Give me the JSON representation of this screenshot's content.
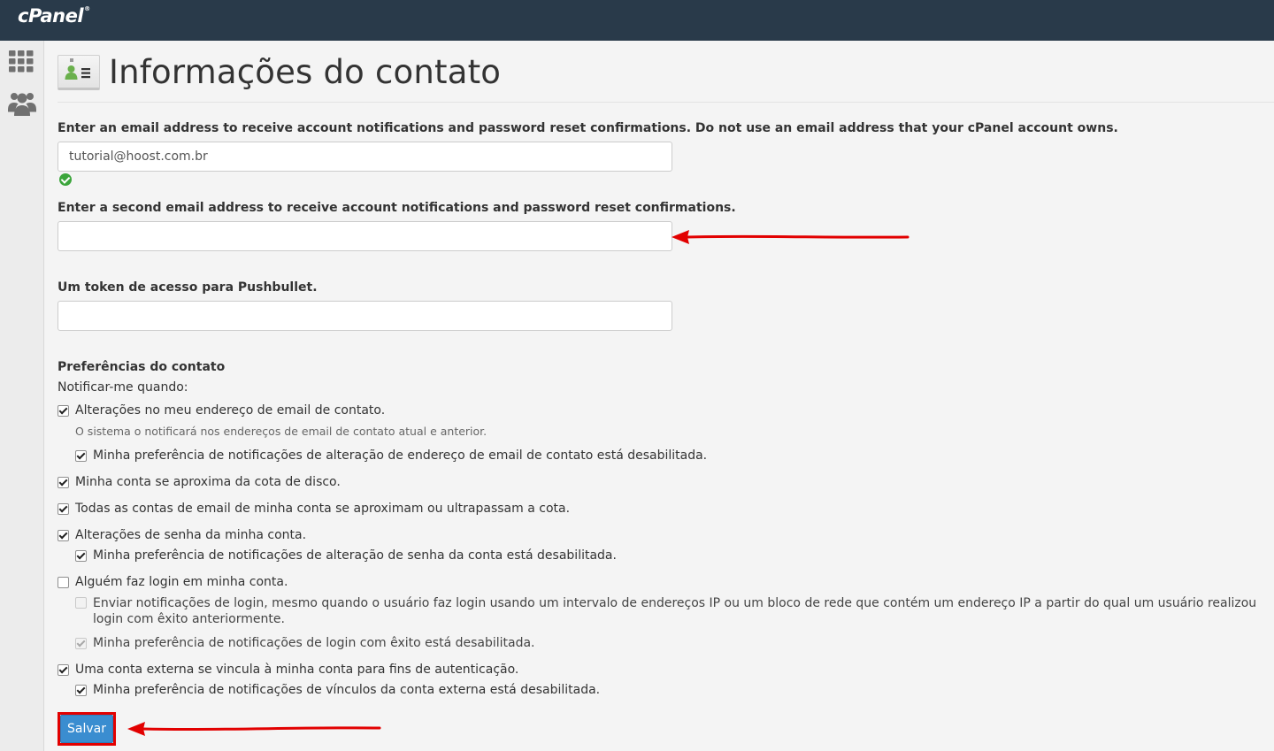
{
  "app": {
    "logo_text": "cPanel",
    "logo_mark": "®"
  },
  "sidebar": {
    "items": [
      {
        "icon": "grid-icon"
      },
      {
        "icon": "users-icon"
      }
    ]
  },
  "page": {
    "title": "Informações do contato",
    "icon": "contact-card-icon"
  },
  "form": {
    "email1_label": "Enter an email address to receive account notifications and password reset confirmations. Do not use an email address that your cPanel account owns.",
    "email1_value": "tutorial@hoost.com.br",
    "email1_status": "valid",
    "email2_label": "Enter a second email address to receive account notifications and password reset confirmations.",
    "email2_value": "",
    "pushbullet_label": "Um token de acesso para Pushbullet.",
    "pushbullet_value": "",
    "prefs_heading": "Preferências do contato",
    "notify_label": "Notificar-me quando:",
    "options": [
      {
        "label": "Alterações no meu endereço de email de contato.",
        "checked": true,
        "disabled": false
      },
      {
        "help": "O sistema o notificará nos endereços de email de contato atual e anterior."
      },
      {
        "label": "Minha preferência de notificações de alteração de endereço de email de contato está desabilitada.",
        "checked": true,
        "disabled": false
      },
      {
        "label": "Minha conta se aproxima da cota de disco.",
        "checked": true,
        "disabled": false
      },
      {
        "label": "Todas as contas de email de minha conta se aproximam ou ultrapassam a cota.",
        "checked": true,
        "disabled": false
      },
      {
        "label": "Alterações de senha da minha conta.",
        "checked": true,
        "disabled": false
      },
      {
        "label": "Minha preferência de notificações de alteração de senha da conta está desabilitada.",
        "checked": true,
        "disabled": false
      },
      {
        "label": "Alguém faz login em minha conta.",
        "checked": false,
        "disabled": false
      },
      {
        "label": "Enviar notificações de login, mesmo quando o usuário faz login usando um intervalo de endereços IP ou um bloco de rede que contém um endereço IP a partir do qual um usuário realizou login com êxito anteriormente.",
        "checked": false,
        "disabled": true
      },
      {
        "label": "Minha preferência de notificações de login com êxito está desabilitada.",
        "checked": true,
        "disabled": true
      },
      {
        "label": "Uma conta externa se vincula à minha conta para fins de autenticação.",
        "checked": true,
        "disabled": false
      },
      {
        "label": "Minha preferência de notificações de vínculos da conta externa está desabilitada.",
        "checked": true,
        "disabled": false
      }
    ],
    "save_label": "Salvar"
  },
  "colors": {
    "topbar": "#293a4a",
    "button": "#3a8dd0",
    "annotation_red": "#e20000",
    "valid_green": "#3ba53b"
  }
}
